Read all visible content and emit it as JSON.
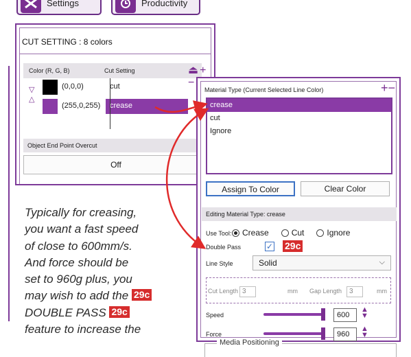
{
  "top_buttons": {
    "settings_label": "Settings",
    "productivity_label": "Productivity"
  },
  "cut_setting": {
    "title": "CUT SETTING : 8 colors",
    "col_color": "Color (R, G, B)",
    "col_setting": "Cut Setting",
    "rows": [
      {
        "rgb": "(0,0,0)",
        "setting": "cut",
        "swatch": "#000000"
      },
      {
        "rgb": "(255,0,255)",
        "setting": "crease",
        "swatch": "#8a3ba6"
      }
    ],
    "overcut_label": "Object End Point Overcut",
    "overcut_value": "Off"
  },
  "note": {
    "lines": [
      "Typically for creasing,",
      "you want a fast speed",
      "of close to 600mm/s.",
      "And force should be",
      "set to 960g plus, you",
      "may wish to add the"
    ],
    "last_line": "DOUBLE PASS",
    "cut_line": "feature to increase the",
    "tag": "29c"
  },
  "material": {
    "title": "Material Type (Current Selected Line Color)",
    "items": [
      "crease",
      "cut",
      "Ignore"
    ],
    "assign_label": "Assign To Color",
    "clear_label": "Clear Color",
    "editing_label": "Editing Material Type: crease",
    "use_tool_label": "Use Tool:",
    "tool_options": [
      "Crease",
      "Cut",
      "Ignore"
    ],
    "double_pass_label": "Double Pass",
    "double_pass_tag": "29c",
    "line_style_label": "Line Style",
    "line_style_value": "Solid",
    "cut_length_label": "Cut Length",
    "cut_length_value": "3",
    "gap_length_label": "Gap Length",
    "gap_length_value": "3",
    "unit": "mm",
    "speed_label": "Speed",
    "speed_value": "600",
    "force_label": "Force",
    "force_value": "960",
    "media_label": "Media Positioning"
  },
  "colors": {
    "accent": "#7a2e91",
    "highlight": "#8a3ba6",
    "arrow": "#e02a2a",
    "tag": "#d62d2d"
  }
}
